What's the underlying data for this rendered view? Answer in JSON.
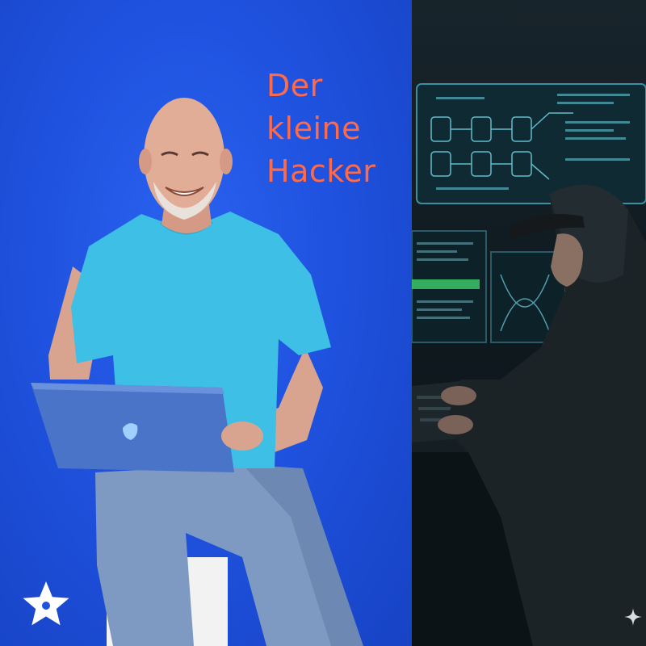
{
  "title_lines": [
    "Der",
    "kleine",
    "Hacker"
  ],
  "colors": {
    "left_background": "#1f52df",
    "title_text": "#ff6b4a",
    "shirt": "#3dbfe6",
    "laptop": "#4a74c8",
    "right_background": "#0f1a20",
    "screen_glow": "#6fd6e6"
  },
  "icons": {
    "brand_logo": "white-star-flower-icon",
    "corner_mark": "sparkle-icon"
  }
}
